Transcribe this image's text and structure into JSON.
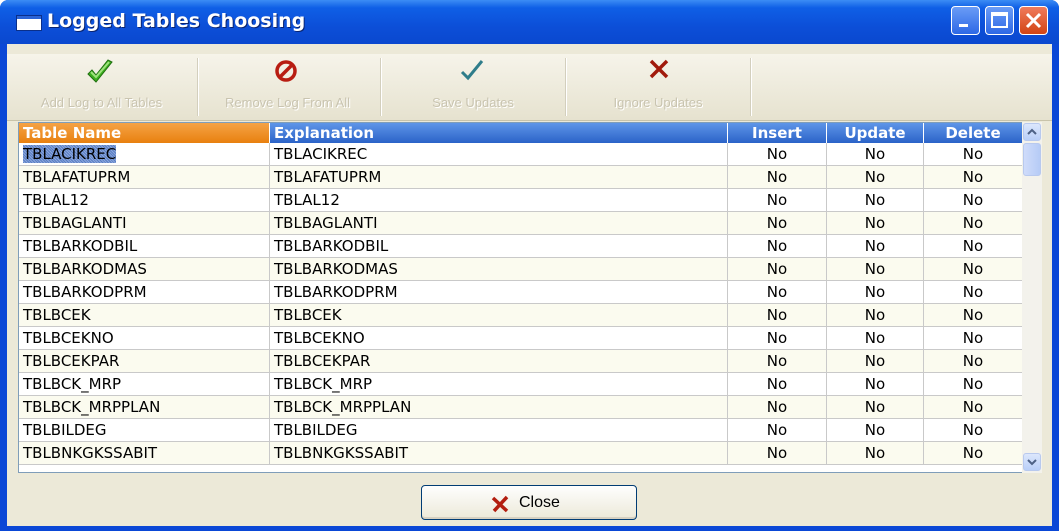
{
  "window": {
    "title": "Logged Tables Choosing"
  },
  "toolbar": {
    "add_log_all": "Add Log to All Tables",
    "remove_log_all": "Remove Log From All",
    "save_updates": "Save Updates",
    "ignore_updates": "Ignore Updates"
  },
  "grid": {
    "columns": [
      "Table Name",
      "Explanation",
      "Insert",
      "Update",
      "Delete"
    ],
    "rows": [
      [
        "TBLACIKREC",
        "TBLACIKREC",
        "No",
        "No",
        "No"
      ],
      [
        "TBLAFATUPRM",
        "TBLAFATUPRM",
        "No",
        "No",
        "No"
      ],
      [
        "TBLAL12",
        "TBLAL12",
        "No",
        "No",
        "No"
      ],
      [
        "TBLBAGLANTI",
        "TBLBAGLANTI",
        "No",
        "No",
        "No"
      ],
      [
        "TBLBARKODBIL",
        "TBLBARKODBIL",
        "No",
        "No",
        "No"
      ],
      [
        "TBLBARKODMAS",
        "TBLBARKODMAS",
        "No",
        "No",
        "No"
      ],
      [
        "TBLBARKODPRM",
        "TBLBARKODPRM",
        "No",
        "No",
        "No"
      ],
      [
        "TBLBCEK",
        "TBLBCEK",
        "No",
        "No",
        "No"
      ],
      [
        "TBLBCEKNO",
        "TBLBCEKNO",
        "No",
        "No",
        "No"
      ],
      [
        "TBLBCEKPAR",
        "TBLBCEKPAR",
        "No",
        "No",
        "No"
      ],
      [
        "TBLBCK_MRP",
        "TBLBCK_MRP",
        "No",
        "No",
        "No"
      ],
      [
        "TBLBCK_MRPPLAN",
        "TBLBCK_MRPPLAN",
        "No",
        "No",
        "No"
      ],
      [
        "TBLBILDEG",
        "TBLBILDEG",
        "No",
        "No",
        "No"
      ],
      [
        "TBLBNKGKSSABIT",
        "TBLBNKGKSSABIT",
        "No",
        "No",
        "No"
      ]
    ]
  },
  "footer": {
    "close_label": "Close"
  },
  "colors": {
    "titlebar": "#0c4fd8",
    "header": "#2b63c8",
    "selected_header": "#e8800f",
    "client": "#ece9d8"
  },
  "icons": [
    "window-icon",
    "minimize-icon",
    "maximize-icon",
    "close-icon",
    "check-add-icon",
    "no-entry-icon",
    "checkmark-icon",
    "x-icon",
    "close-x-icon"
  ]
}
